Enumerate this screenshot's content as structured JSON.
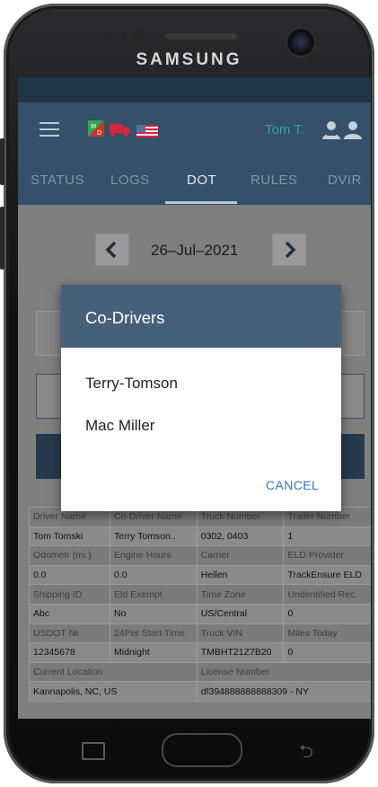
{
  "device": {
    "brand": "SAMSUNG"
  },
  "appbar": {
    "user_name": "Tom T."
  },
  "tabs": [
    {
      "label": "STATUS",
      "active": false
    },
    {
      "label": "LOGS",
      "active": false
    },
    {
      "label": "DOT",
      "active": true
    },
    {
      "label": "RULES",
      "active": false
    },
    {
      "label": "DVIR",
      "active": false
    }
  ],
  "date_nav": {
    "date": "26–Jul–2021",
    "prev_icon": "chevron-left-icon",
    "next_icon": "chevron-right-icon"
  },
  "dialog": {
    "title": "Co-Drivers",
    "items": [
      "Terry-Tomson",
      "Mac Miller"
    ],
    "cancel_label": "CANCEL"
  },
  "table": {
    "rows": [
      {
        "type": "lab",
        "cells": [
          "Driver Name",
          "Co-Driver Name",
          "Truck Number",
          "Trailer Number"
        ]
      },
      {
        "type": "val",
        "cells": [
          "Tom Tomski",
          "Terry Tomson..",
          "0302, 0403",
          "1"
        ]
      },
      {
        "type": "lab",
        "cells": [
          "Odometr (mi.)",
          "Engine Hours",
          "Carrier",
          "ELD Provider"
        ]
      },
      {
        "type": "val",
        "cells": [
          "0.0",
          "0.0",
          "Hellen",
          "TrackEnsure ELD"
        ]
      },
      {
        "type": "lab",
        "cells": [
          "Shipping ID",
          "Eld Exempt",
          "Time Zone",
          "Undentified Rec."
        ]
      },
      {
        "type": "val",
        "cells": [
          "Abc",
          "No",
          "US/Central",
          "0"
        ]
      },
      {
        "type": "lab",
        "cells": [
          "USDOT №",
          "24Per Start Time",
          "Truck VIN",
          "Miles Today"
        ]
      },
      {
        "type": "val",
        "cells": [
          "12345678",
          "Midnight",
          "TMBHT21Z7B20",
          "0"
        ]
      },
      {
        "type": "lab2",
        "cells": [
          "Current Location",
          "License Number"
        ]
      },
      {
        "type": "val2",
        "cells": [
          "Kannapolis, NC, US",
          "df394888888888309 - NY"
        ]
      }
    ]
  },
  "colors": {
    "appbar": "#34506b",
    "dialog_header": "#46607a",
    "cancel": "#2c78c9",
    "user_name": "#2fa89a"
  }
}
